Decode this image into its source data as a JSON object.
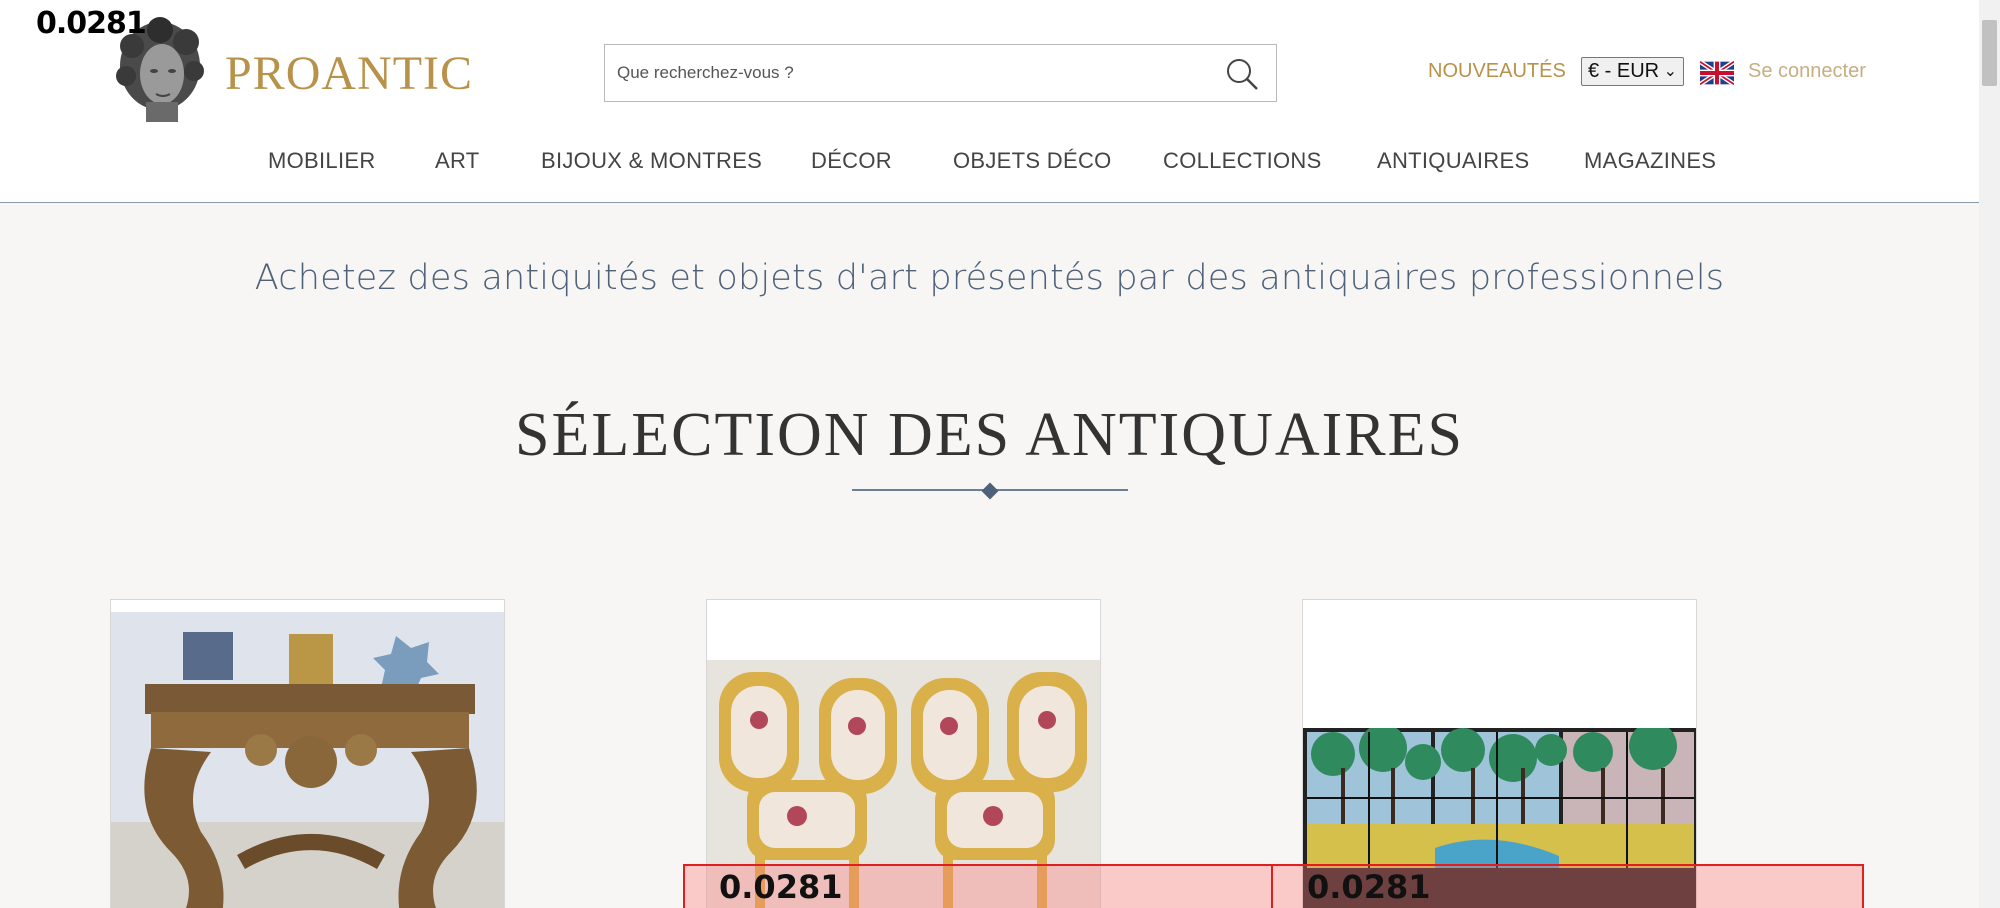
{
  "debug_value": "0.0281",
  "header": {
    "logo_text": "PROANTIC",
    "search_placeholder": "Que recherchez-vous ?",
    "news_label": "NOUVEAUTÉS",
    "currency_value": "€ - EUR",
    "language_icon": "uk-flag-icon",
    "login_label": "Se connecter"
  },
  "nav": {
    "items": [
      "MOBILIER",
      "ART",
      "BIJOUX & MONTRES",
      "DÉCOR",
      "OBJETS DÉCO",
      "COLLECTIONS",
      "ANTIQUAIRES",
      "MAGAZINES"
    ]
  },
  "main": {
    "tagline": "Achetez des antiquités et objets d'art présentés par des antiquaires professionnels",
    "section_title": "SÉLECTION DES ANTIQUAIRES"
  },
  "overlays": [
    {
      "label": "0.0281"
    },
    {
      "label": "0.0281"
    }
  ],
  "colors": {
    "brand_gold": "#b8924a",
    "heading_blue": "#4e6178"
  }
}
